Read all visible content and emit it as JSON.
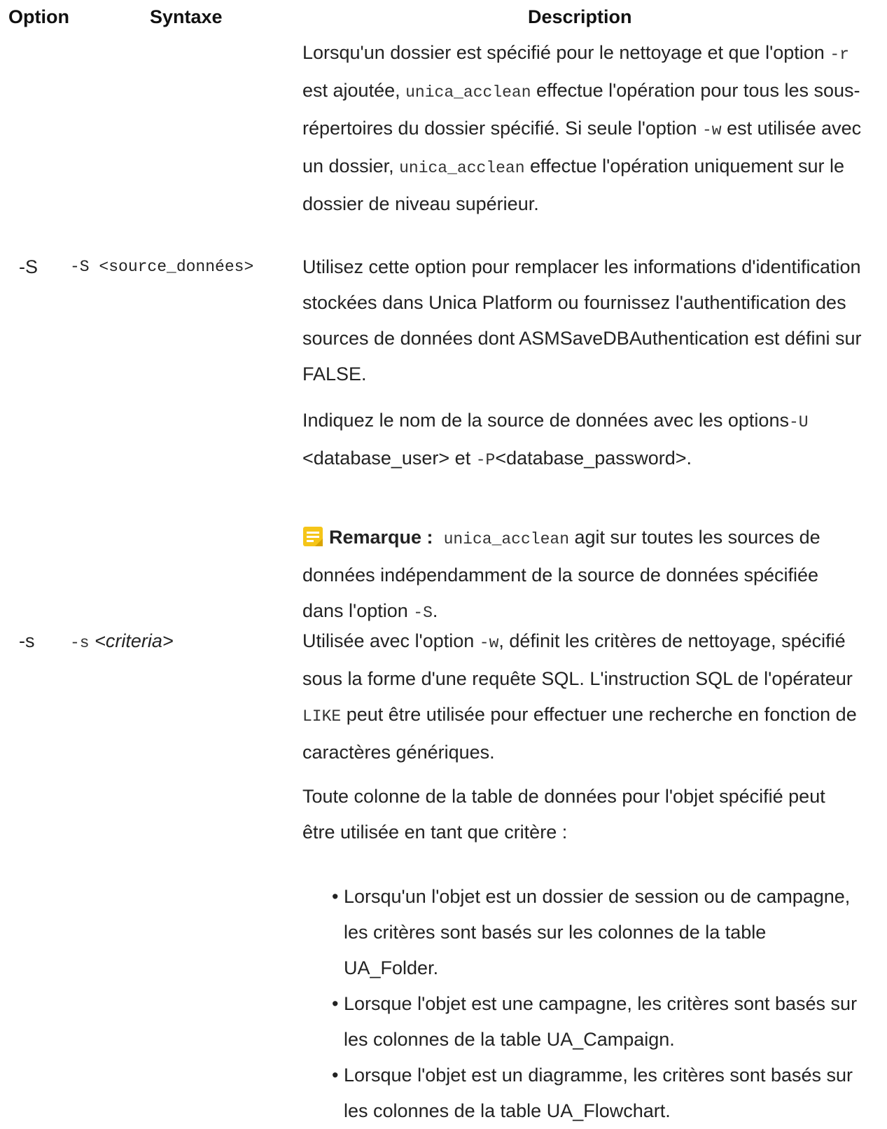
{
  "header": {
    "option": "Option",
    "syntaxe": "Syntaxe",
    "description": "Description"
  },
  "row0": {
    "p1": {
      "t1": "Lorsqu'un dossier est spécifié pour le nettoyage et que l'option ",
      "c1": "-r",
      "t2": " est ajoutée, ",
      "c2": "unica_acclean",
      "t3": " effectue l'opération pour tous les sous-répertoires du dossier spécifié. Si seule l'option ",
      "c3": "-w",
      "t4": " est utilisée avec un dossier, ",
      "c4": "unica_acclean",
      "t5": " effectue l'opération uniquement sur le dossier de niveau supérieur."
    }
  },
  "row1": {
    "option": "-S",
    "syntax": "-S <source_données>",
    "p1": "Utilisez cette option pour remplacer les informations d'identification stockées dans Unica Platform ou fournissez l'authentification des sources de données dont ASMSaveDBAuthentication est défini sur FALSE.",
    "p2": {
      "t1": "Indiquez le nom de la source de données avec les options",
      "c1": "-U",
      "t2": " <database_user> et ",
      "c2": "-P",
      "t3": "<database_password>."
    },
    "note": {
      "label": "Remarque :",
      "c1": "unica_acclean",
      "t1": " agit sur toutes les sources de données indépendamment de la source de données spécifiée dans l'option ",
      "c2": "-S",
      "t2": "."
    }
  },
  "row2": {
    "option": "-s",
    "syntax_code": "-s",
    "syntax_arg": "<criteria>",
    "p1": {
      "t1": "Utilisée avec l'option ",
      "c1": "-w",
      "t2": ", définit les critères de nettoyage, spécifié sous la forme d'une requête SQL. L'instruction SQL de l'opérateur ",
      "c2": "LIKE",
      "t3": " peut être utilisée pour effectuer une recherche en fonction de caractères génériques."
    },
    "p2": "Toute colonne de la table de données pour l'objet spécifié peut être utilisée en tant que critère :",
    "bullets": [
      "Lorsqu'un l'objet est un dossier de session ou de campagne, les critères sont basés sur les colonnes de la table UA_Folder.",
      "Lorsque l'objet est une campagne, les critères sont basés sur les colonnes de la table UA_Campaign.",
      "Lorsque l'objet est un diagramme, les critères sont basés sur les colonnes de la table UA_Flowchart."
    ]
  },
  "colors": {
    "note_icon": "#f5c518",
    "text": "#222222"
  },
  "icons": {
    "note": "note-icon"
  }
}
